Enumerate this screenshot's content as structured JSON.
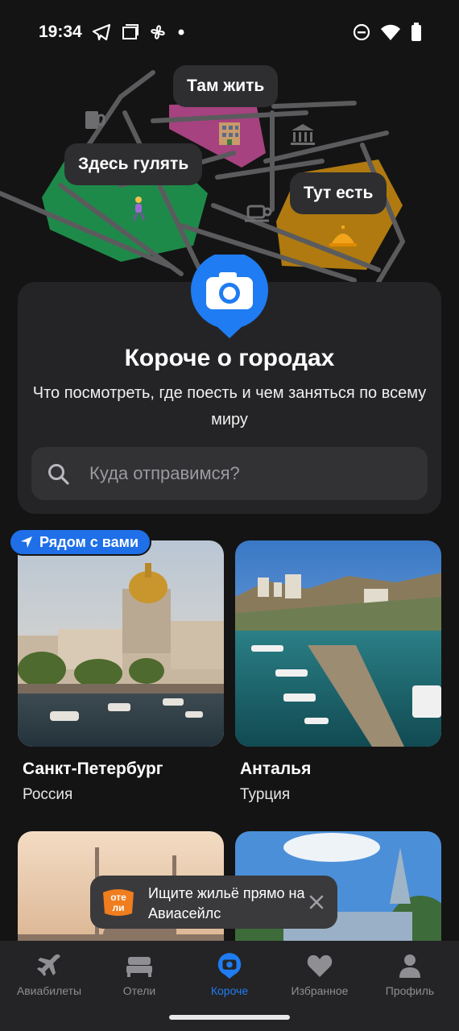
{
  "status_bar": {
    "time": "19:34",
    "left_icons": [
      "telegram-icon",
      "screen-icon",
      "fan-icon",
      "dot-icon"
    ],
    "right_icons": [
      "do-not-disturb-icon",
      "wifi-icon",
      "battery-icon"
    ]
  },
  "hero": {
    "bubbles": {
      "live": "Там жить",
      "walk": "Здесь гулять",
      "eat": "Тут есть"
    },
    "zone_colors": {
      "walk": "#1e8a4a",
      "live": "#a6427f",
      "eat": "#b07a10"
    }
  },
  "intro": {
    "title": "Короче о городах",
    "subtitle": "Что посмотреть, где поесть и чем заняться по всему миру",
    "search_placeholder": "Куда отправимся?"
  },
  "nearby_badge": "Рядом с вами",
  "cities": [
    {
      "name": "Санкт-Петербург",
      "country": "Россия"
    },
    {
      "name": "Анталья",
      "country": "Турция"
    }
  ],
  "toast": {
    "logo_text": "оте ли",
    "text": "Ищите жильё прямо на Авиасейлс"
  },
  "nav": {
    "items": [
      {
        "label": "Авиабилеты",
        "icon": "plane-icon"
      },
      {
        "label": "Отели",
        "icon": "bed-icon"
      },
      {
        "label": "Короче",
        "icon": "camera-pin-icon"
      },
      {
        "label": "Избранное",
        "icon": "heart-icon"
      },
      {
        "label": "Профиль",
        "icon": "person-icon"
      }
    ],
    "active_index": 2
  },
  "colors": {
    "accent": "#1f7cf2",
    "background": "#141414",
    "card": "#242426"
  }
}
